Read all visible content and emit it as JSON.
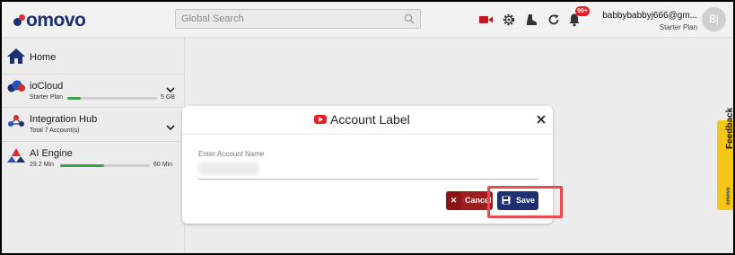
{
  "header": {
    "logo_text": "omovo",
    "search_placeholder": "Global Search",
    "notification_badge": "99+",
    "user_email": "babbybabbyj666@gm...",
    "user_plan": "Starter Plan",
    "avatar_initials": "Bj",
    "icons": [
      "video-icon",
      "gear-icon",
      "boot-icon",
      "refresh-icon",
      "bell-icon"
    ],
    "accent_red": "#e21d1d"
  },
  "sidebar": {
    "items": [
      {
        "label": "Home",
        "icon": "home-icon"
      },
      {
        "label": "ioCloud",
        "sub": "Starter Plan",
        "right": "5 GB",
        "progress": 0.15,
        "icon": "cloud-icon"
      },
      {
        "label": "Integration Hub",
        "sub": "Total 7 Account(s)",
        "icon": "hub-icon"
      },
      {
        "label": "AI Engine",
        "sub": "29.2 Min",
        "right": "60 Min",
        "progress": 0.49,
        "icon": "ai-engine-icon"
      }
    ]
  },
  "modal": {
    "title": "Account Label",
    "field_label": "Enter Account Name",
    "field_value": "",
    "cancel_label": "Cancel",
    "save_label": "Save",
    "brand_navy": "#1d3071",
    "cancel_red": "#9e1d1f"
  },
  "feedback": {
    "label": "Feedback",
    "brand": "omovo"
  }
}
